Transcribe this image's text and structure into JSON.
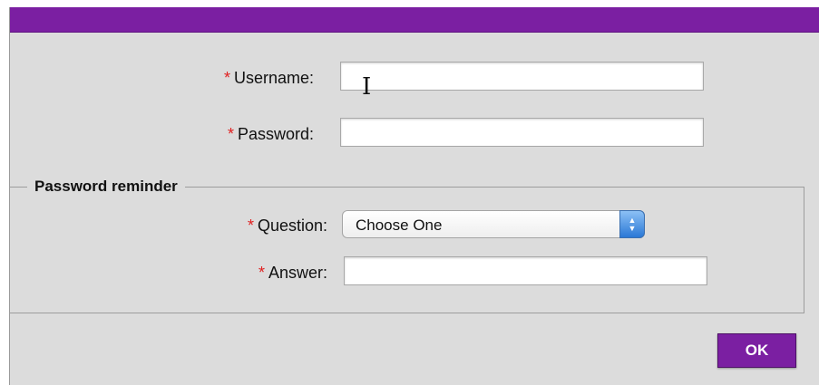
{
  "form": {
    "required_marker": "*",
    "username": {
      "label": "Username:",
      "value": ""
    },
    "password": {
      "label": "Password:",
      "value": ""
    }
  },
  "reminder": {
    "legend": "Password reminder",
    "question": {
      "label": "Question:",
      "selected": "Choose One"
    },
    "answer": {
      "label": "Answer:",
      "value": ""
    }
  },
  "actions": {
    "ok_label": "OK"
  },
  "cursor": {
    "glyph": "I"
  },
  "colors": {
    "accent": "#7b1fa2",
    "required": "#e02020",
    "panel_background": "#dcdcdc"
  }
}
